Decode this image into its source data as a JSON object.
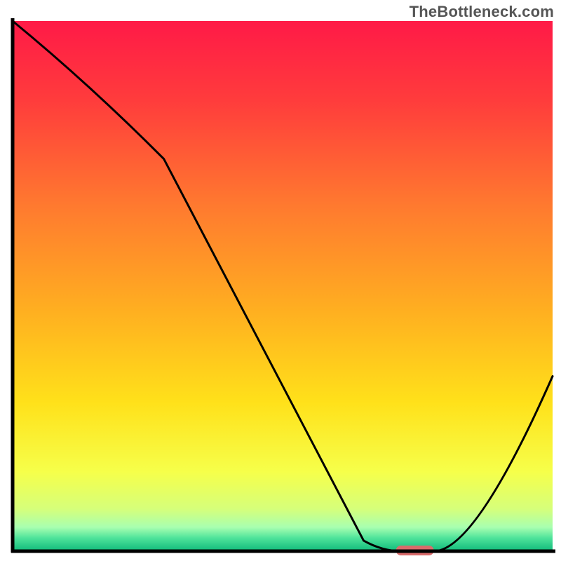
{
  "watermark": "TheBottleneck.com",
  "chart_data": {
    "type": "line",
    "title": "",
    "xlabel": "",
    "ylabel": "",
    "xlim": [
      0,
      100
    ],
    "ylim": [
      0,
      100
    ],
    "x": [
      0,
      28,
      65,
      72,
      78,
      100
    ],
    "values": [
      100,
      74,
      2,
      0,
      0,
      33
    ],
    "optimal_marker": {
      "x_start": 71,
      "x_end": 78,
      "y": 0
    },
    "gradient_stops": [
      {
        "offset": 0.0,
        "color": "#ff1a47"
      },
      {
        "offset": 0.15,
        "color": "#ff3c3c"
      },
      {
        "offset": 0.35,
        "color": "#ff7a2f"
      },
      {
        "offset": 0.55,
        "color": "#ffb020"
      },
      {
        "offset": 0.72,
        "color": "#ffe11a"
      },
      {
        "offset": 0.85,
        "color": "#f6ff4a"
      },
      {
        "offset": 0.92,
        "color": "#d6ff7a"
      },
      {
        "offset": 0.955,
        "color": "#a8ffb0"
      },
      {
        "offset": 0.975,
        "color": "#4fe39b"
      },
      {
        "offset": 1.0,
        "color": "#0fb97a"
      }
    ],
    "marker_color": "#d96b6b",
    "curve_color": "#000000",
    "axis_color": "#000000"
  }
}
